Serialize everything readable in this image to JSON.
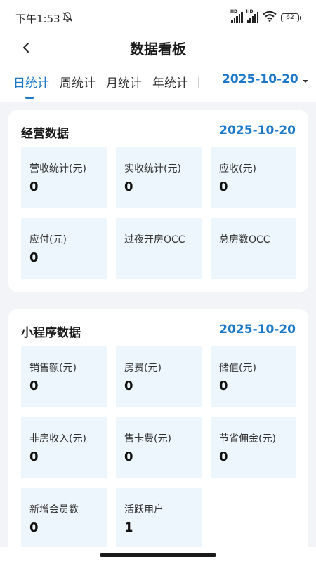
{
  "status_bar": {
    "time": "下午1:53",
    "battery": "62",
    "net_badge_1": "HD",
    "net_badge_2": "HD"
  },
  "header": {
    "title": "数据看板"
  },
  "tabs": [
    {
      "label": "日统计"
    },
    {
      "label": "周统计"
    },
    {
      "label": "月统计"
    },
    {
      "label": "年统计"
    }
  ],
  "date_picker": {
    "value": "2025-10-20"
  },
  "business": {
    "title": "经营数据",
    "date": "2025-10-20",
    "tiles": [
      {
        "label": "营收统计(元)",
        "value": "0"
      },
      {
        "label": "实收统计(元)",
        "value": "0"
      },
      {
        "label": "应收(元)",
        "value": "0"
      },
      {
        "label": "应付(元)",
        "value": "0"
      },
      {
        "label": "过夜开房OCC",
        "value": ""
      },
      {
        "label": "总房数OCC",
        "value": ""
      }
    ]
  },
  "miniprogram": {
    "title": "小程序数据",
    "date": "2025-10-20",
    "tiles": [
      {
        "label": "销售额(元)",
        "value": "0"
      },
      {
        "label": "房费(元)",
        "value": "0"
      },
      {
        "label": "储值(元)",
        "value": "0"
      },
      {
        "label": "非房收入(元)",
        "value": "0"
      },
      {
        "label": "售卡费(元)",
        "value": "0"
      },
      {
        "label": "节省佣金(元)",
        "value": "0"
      },
      {
        "label": "新增会员数",
        "value": "0"
      },
      {
        "label": "活跃用户",
        "value": "1"
      }
    ]
  },
  "colors": {
    "accent": "#1e78c8",
    "tile_bg": "#edf5fd",
    "page_bg": "#f2f4f7"
  },
  "icons": [
    "back-arrow-icon",
    "bell-off-icon",
    "signal-icon",
    "wifi-icon",
    "battery-icon",
    "caret-down-icon"
  ]
}
